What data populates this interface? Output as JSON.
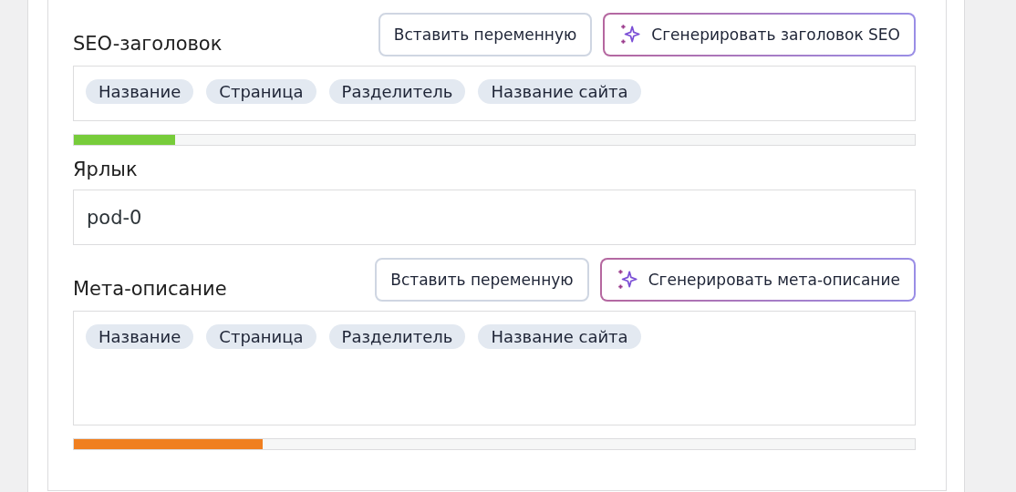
{
  "fields": [
    {
      "kind": "tag-input",
      "label": "SEO-заголовок",
      "buttons": [
        {
          "kind": "plain",
          "label": "Вставить переменную"
        },
        {
          "kind": "ai",
          "label": "Сгенерировать заголовок SEO"
        }
      ],
      "tags": [
        "Название",
        "Страница",
        "Разделитель",
        "Название сайта"
      ],
      "meter": {
        "level": 0.12,
        "color": "#77cc3a"
      }
    },
    {
      "kind": "text",
      "label": "Ярлык",
      "value": "pod-0"
    },
    {
      "kind": "tag-textarea",
      "label": "Мета-описание",
      "buttons": [
        {
          "kind": "plain",
          "label": "Вставить переменную"
        },
        {
          "kind": "ai",
          "label": "Сгенерировать мета-описание"
        }
      ],
      "tags": [
        "Название",
        "Страница",
        "Разделитель",
        "Название сайта"
      ],
      "meter": {
        "level": 0.224,
        "color": "#f07f1f"
      }
    }
  ]
}
